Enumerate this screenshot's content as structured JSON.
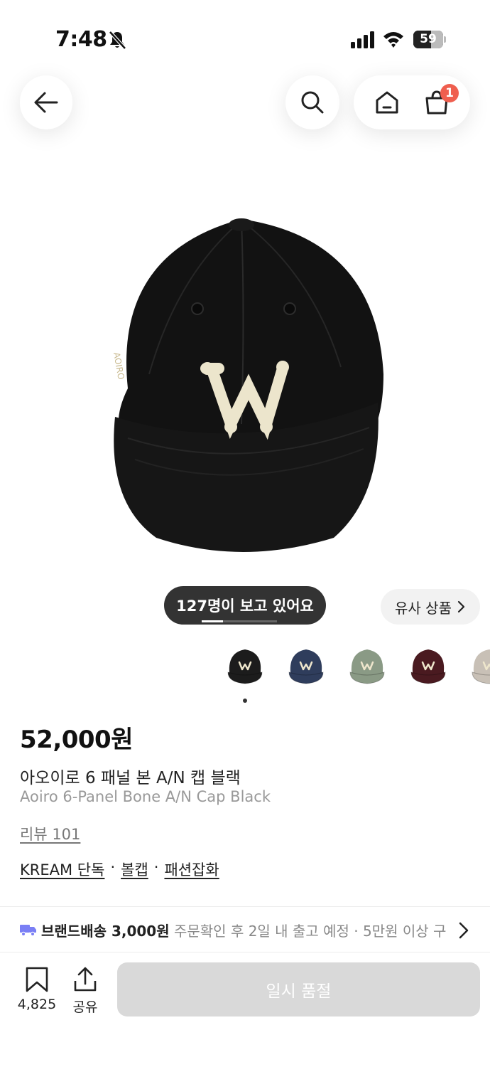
{
  "status_bar": {
    "time": "7:48",
    "battery": "59",
    "battery_level": 0.59,
    "icons": [
      "bell-slash-icon",
      "cellular-signal-icon",
      "wifi-icon",
      "battery-icon"
    ]
  },
  "nav": {
    "cart_badge": "1",
    "icons": [
      "arrow-left-icon",
      "search-icon",
      "home-icon",
      "shopping-bag-icon"
    ]
  },
  "gallery": {
    "viewers_text": "127명이 보고 있어요",
    "similar_label": "유사 상품",
    "thumbnail_colors": [
      "#1c1c1c",
      "#2f3d5c",
      "#8a9a85",
      "#4a1a20",
      "#c8c0b6"
    ],
    "thumbnail_count": 5
  },
  "product": {
    "price": "52,000원",
    "name_kr": "아오이로 6 패널 본 A/N 캡 블랙",
    "name_en": "Aoiro 6-Panel Bone A/N Cap Black",
    "review": "리뷰 101",
    "tags": [
      "KREAM 단독",
      "볼캡",
      "패션잡화"
    ],
    "tag_separator": "·"
  },
  "shipping": {
    "label": "브랜드배송 3,000원",
    "detail": " 주문확인 후 2일 내 출고 예정 · 5만원 이상 구",
    "icon": "truck-icon"
  },
  "bottom_bar": {
    "bookmark_count": "4,825",
    "share_label": "공유",
    "soldout_label": "일시 품절"
  }
}
